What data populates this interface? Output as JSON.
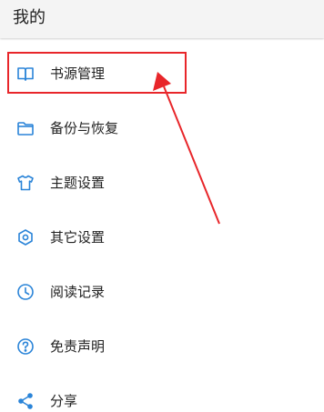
{
  "header": {
    "title": "我的"
  },
  "menu": {
    "items": [
      {
        "label": "书源管理",
        "icon": "book-icon"
      },
      {
        "label": "备份与恢复",
        "icon": "folder-icon"
      },
      {
        "label": "主题设置",
        "icon": "tshirt-icon"
      },
      {
        "label": "其它设置",
        "icon": "hexagon-settings-icon"
      },
      {
        "label": "阅读记录",
        "icon": "clock-icon"
      },
      {
        "label": "免责声明",
        "icon": "question-icon"
      },
      {
        "label": "分享",
        "icon": "share-icon"
      }
    ]
  },
  "colors": {
    "accent": "#2a84d8",
    "annotation": "#e8262a",
    "header_bg": "#f4f4f4",
    "text": "#222222"
  }
}
